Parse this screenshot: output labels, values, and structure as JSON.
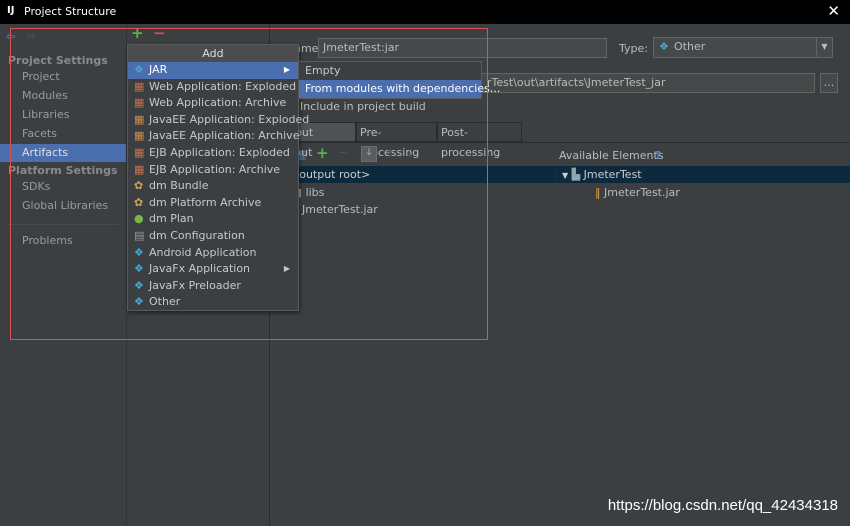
{
  "window": {
    "title": "Project Structure",
    "logo": "IJ",
    "close": "✕"
  },
  "sidebar": {
    "project_settings": "Project Settings",
    "items": [
      "Project",
      "Modules",
      "Libraries",
      "Facets",
      "Artifacts"
    ],
    "platform_settings": "Platform Settings",
    "platform_items": [
      "SDKs",
      "Global Libraries"
    ],
    "problems": "Problems",
    "selected": "Artifacts"
  },
  "toolbar": {
    "add": "+",
    "remove": "−"
  },
  "add_menu": {
    "header": "Add",
    "items": [
      {
        "label": "JAR",
        "icon": "diamond-icon",
        "submenu": true
      },
      {
        "label": "Web Application: Exploded",
        "icon": "web-app-icon"
      },
      {
        "label": "Web Application: Archive",
        "icon": "web-app-icon"
      },
      {
        "label": "JavaEE Application: Exploded",
        "icon": "javaee-icon"
      },
      {
        "label": "JavaEE Application: Archive",
        "icon": "javaee-icon"
      },
      {
        "label": "EJB Application: Exploded",
        "icon": "ejb-icon"
      },
      {
        "label": "EJB Application: Archive",
        "icon": "ejb-icon"
      },
      {
        "label": "dm Bundle",
        "icon": "bundle-icon"
      },
      {
        "label": "dm Platform Archive",
        "icon": "bundle-icon"
      },
      {
        "label": "dm Plan",
        "icon": "plan-icon"
      },
      {
        "label": "dm Configuration",
        "icon": "config-file-icon"
      },
      {
        "label": "Android Application",
        "icon": "diamond-icon"
      },
      {
        "label": "JavaFx Application",
        "icon": "diamond-icon",
        "submenu": true
      },
      {
        "label": "JavaFx Preloader",
        "icon": "diamond-icon"
      },
      {
        "label": "Other",
        "icon": "diamond-icon"
      }
    ]
  },
  "jar_submenu": {
    "items": [
      "Empty",
      "From modules with dependencies..."
    ],
    "selected": "From modules with dependencies..."
  },
  "form": {
    "name_label": "Name:",
    "name_value": "JmeterTest:jar",
    "type_label": "Type:",
    "type_value": "Other",
    "output_dir": "rTest\\out\\artifacts\\JmeterTest_jar",
    "browse": "...",
    "include_build": "Include in project build"
  },
  "tabs": [
    "Output Layout",
    "Pre-processing",
    "Post-processing"
  ],
  "output_tree": [
    "<output root>",
    "libs",
    "JmeterTest.jar"
  ],
  "available": {
    "label": "Available Elements",
    "help": "?",
    "tree": [
      "JmeterTest",
      "JmeterTest.jar"
    ]
  },
  "watermark": "https://blog.csdn.net/qq_42434318",
  "colors": {
    "selection": "#4b6eaf",
    "tree_selection": "#0d293e",
    "highlight_box": "#e05050"
  }
}
